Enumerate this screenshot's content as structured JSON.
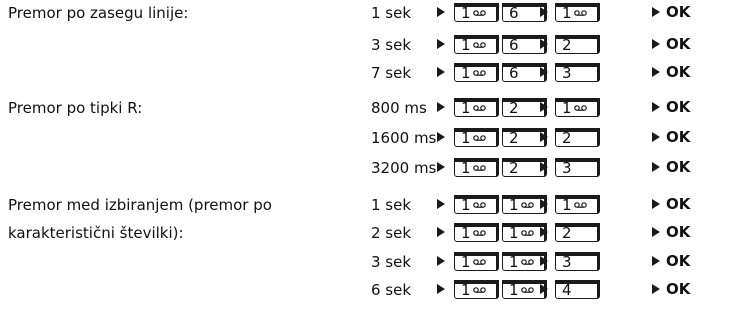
{
  "rows": [
    {
      "label": "Premor po zasegu linije:",
      "value": "1 sek",
      "keys": [
        "1",
        "6",
        "1"
      ],
      "ok": "OK"
    },
    {
      "label": "",
      "value": "3 sek",
      "keys": [
        "1",
        "6",
        "2"
      ],
      "ok": "OK"
    },
    {
      "label": "",
      "value": "7 sek",
      "keys": [
        "1",
        "6",
        "3"
      ],
      "ok": "OK"
    },
    {
      "label": "Premor po tipki R:",
      "value": "800 ms",
      "keys": [
        "1",
        "2",
        "1"
      ],
      "ok": "OK"
    },
    {
      "label": "",
      "value": "1600 ms",
      "keys": [
        "1",
        "2",
        "2"
      ],
      "ok": "OK"
    },
    {
      "label": "",
      "value": "3200 ms",
      "keys": [
        "1",
        "2",
        "3"
      ],
      "ok": "OK"
    },
    {
      "label": "Premor med izbiranjem (premor po",
      "value": "1 sek",
      "keys": [
        "1",
        "1",
        "1"
      ],
      "ok": "OK"
    },
    {
      "label": "karakteristični številki):",
      "value": "2 sek",
      "keys": [
        "1",
        "1",
        "2"
      ],
      "ok": "OK"
    },
    {
      "label": "",
      "value": "3 sek",
      "keys": [
        "1",
        "1",
        "3"
      ],
      "ok": "OK"
    },
    {
      "label": "",
      "value": "6 sek",
      "keys": [
        "1",
        "1",
        "4"
      ],
      "ok": "OK"
    }
  ],
  "icons": {
    "arrow": "play-arrow-icon",
    "voicemail": "voicemail-icon"
  },
  "colors": {
    "text": "#111111",
    "key_border": "#1a1a1a"
  }
}
